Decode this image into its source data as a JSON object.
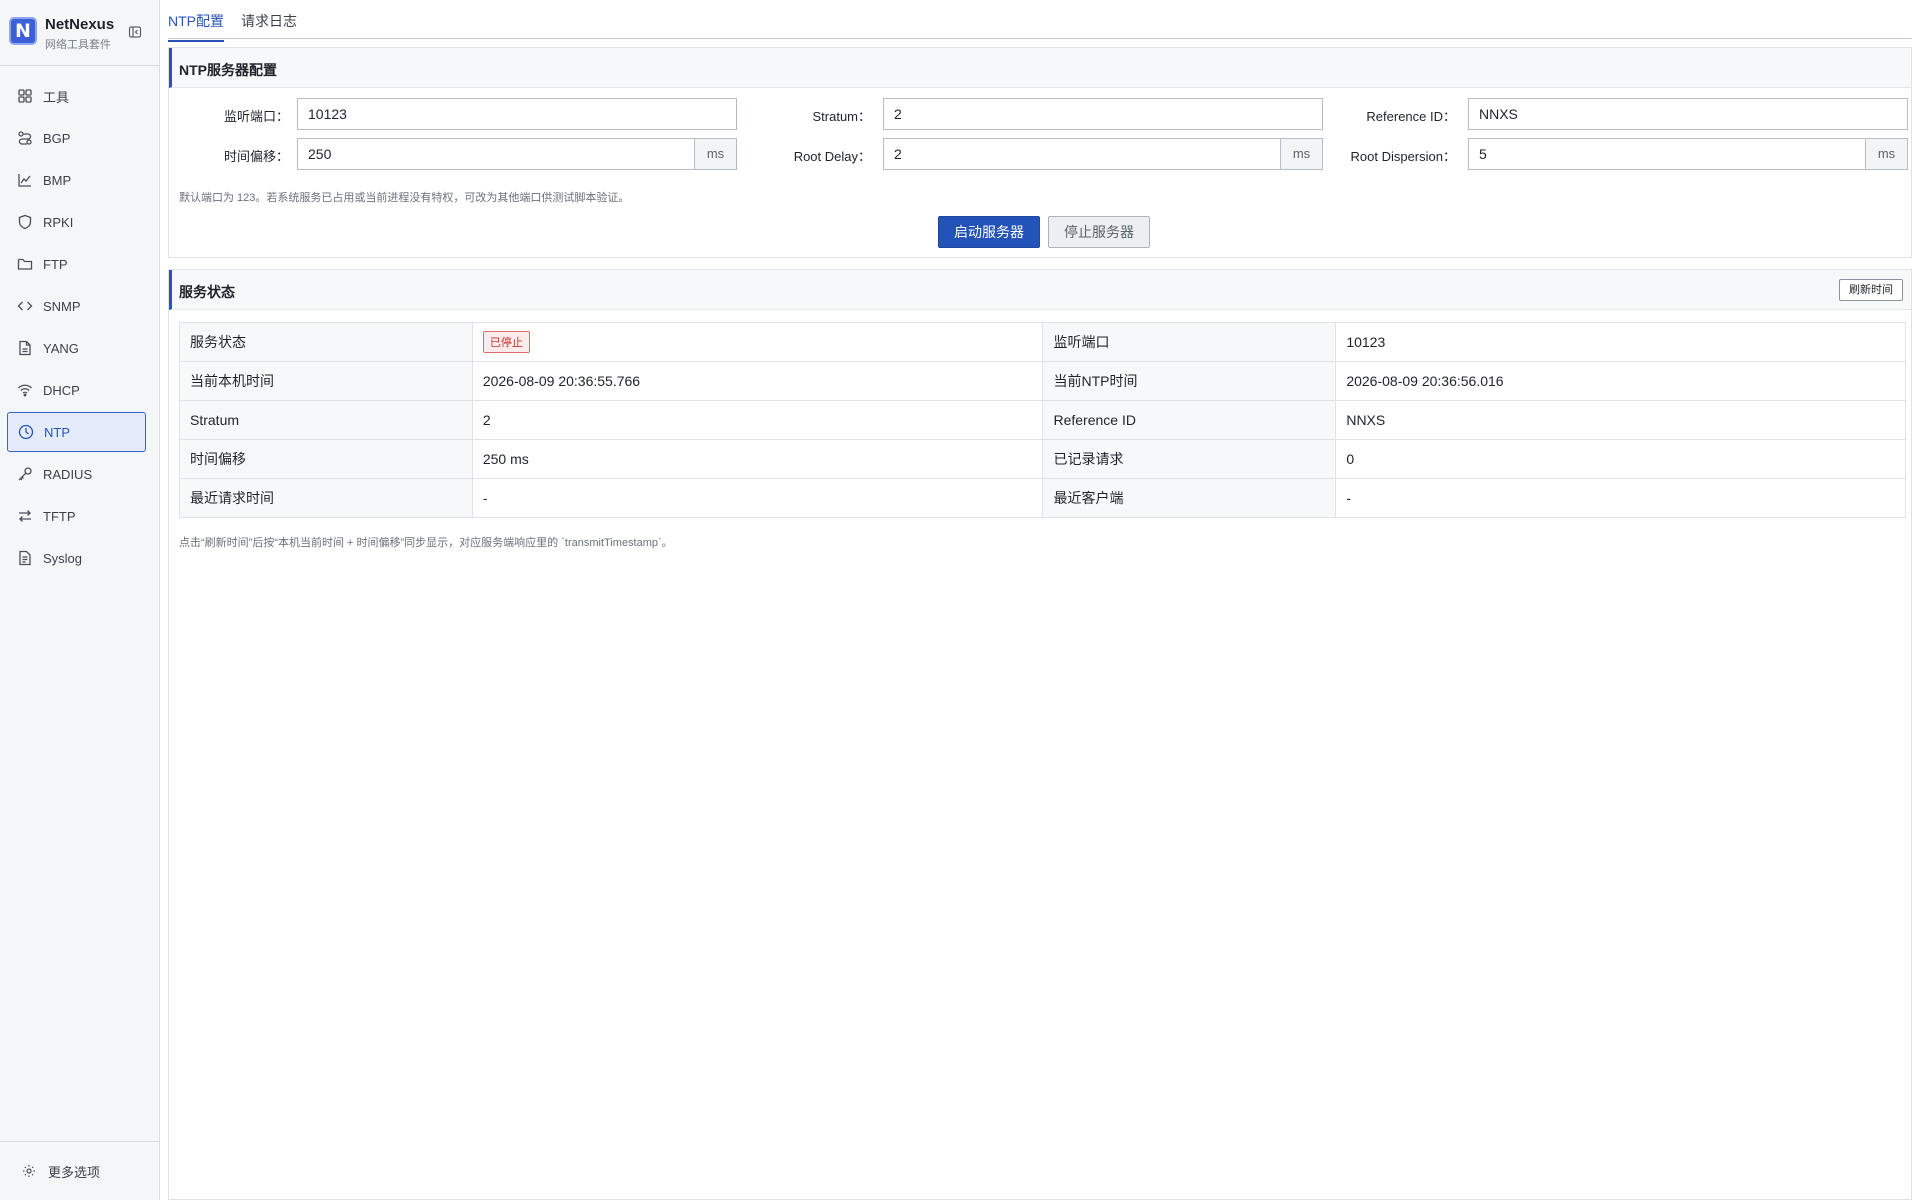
{
  "app": {
    "name": "NetNexus",
    "subtitle": "网络工具套件",
    "logo_letter": "N"
  },
  "sidebar": {
    "items": [
      {
        "label": "工具",
        "icon": "grid-icon"
      },
      {
        "label": "BGP",
        "icon": "routes-icon"
      },
      {
        "label": "BMP",
        "icon": "chart-icon"
      },
      {
        "label": "RPKI",
        "icon": "shield-icon"
      },
      {
        "label": "FTP",
        "icon": "folder-icon"
      },
      {
        "label": "SNMP",
        "icon": "code-icon"
      },
      {
        "label": "YANG",
        "icon": "file-icon"
      },
      {
        "label": "DHCP",
        "icon": "wifi-icon"
      },
      {
        "label": "NTP",
        "icon": "clock-icon",
        "active": true
      },
      {
        "label": "RADIUS",
        "icon": "key-icon"
      },
      {
        "label": "TFTP",
        "icon": "transfer-icon"
      },
      {
        "label": "Syslog",
        "icon": "document-icon"
      }
    ],
    "footer_label": "更多选项"
  },
  "tabs": [
    {
      "label": "NTP配置",
      "active": true
    },
    {
      "label": "请求日志",
      "active": false
    }
  ],
  "config": {
    "title": "NTP服务器配置",
    "listen_port_label": "监听端口：",
    "listen_port_value": "10123",
    "stratum_label": "Stratum：",
    "stratum_value": "2",
    "reference_id_label": "Reference ID：",
    "reference_id_value": "NNXS",
    "time_offset_label": "时间偏移：",
    "time_offset_value": "250",
    "root_delay_label": "Root Delay：",
    "root_delay_value": "2",
    "root_dispersion_label": "Root Dispersion：",
    "root_dispersion_value": "5",
    "unit_ms": "ms",
    "hint": "默认端口为 123。若系统服务已占用或当前进程没有特权，可改为其他端口供测试脚本验证。",
    "start_button": "启动服务器",
    "stop_button": "停止服务器"
  },
  "status": {
    "title": "服务状态",
    "refresh_button": "刷新时间",
    "rows": [
      [
        "服务状态",
        "已停止",
        "监听端口",
        "10123"
      ],
      [
        "当前本机时间",
        "2026-08-09 20:36:55.766",
        "当前NTP时间",
        "2026-08-09 20:36:56.016"
      ],
      [
        "Stratum",
        "2",
        "Reference ID",
        "NNXS"
      ],
      [
        "时间偏移",
        "250 ms",
        "已记录请求",
        "0"
      ],
      [
        "最近请求时间",
        "-",
        "最近客户端",
        "-"
      ]
    ],
    "note": "点击“刷新时间”后按“本机当前时间 + 时间偏移”同步显示，对应服务端响应里的 `transmitTimestamp`。"
  },
  "colors": {
    "accent": "#2b53b8",
    "stopped_badge": "#c8312f"
  }
}
